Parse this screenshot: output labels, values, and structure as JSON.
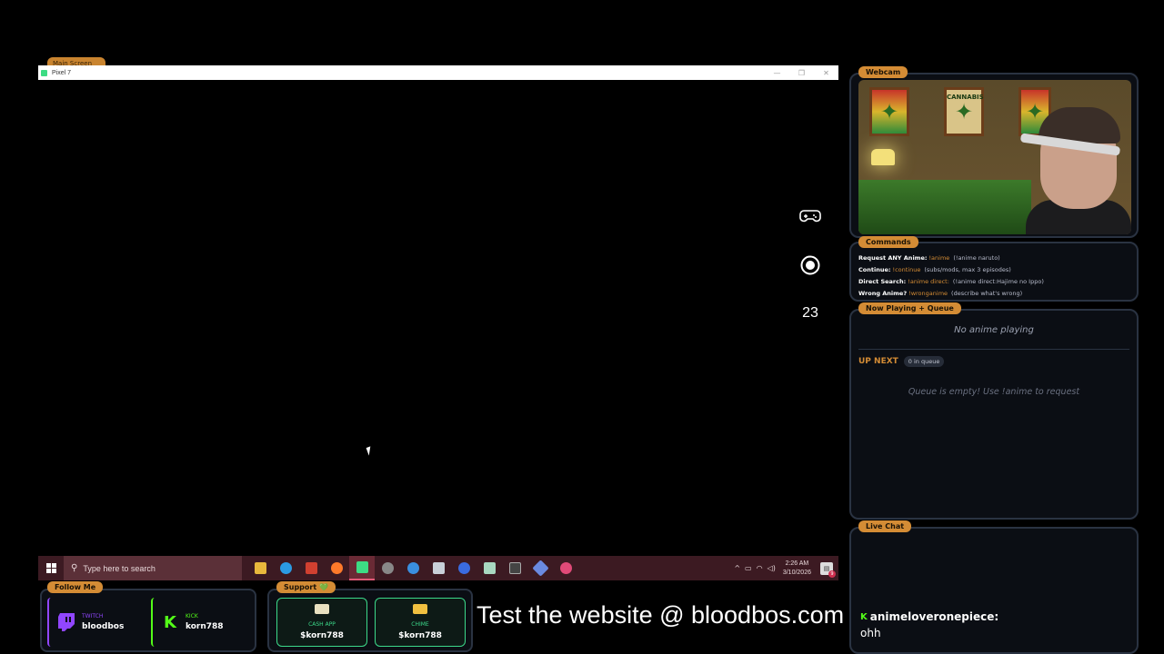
{
  "window": {
    "label": "Main Screen",
    "title": "Pixel 7",
    "controls": [
      "—",
      "❐",
      "✕"
    ],
    "side_number": "23"
  },
  "taskbar": {
    "search_placeholder": "Type here to search",
    "apps": [
      {
        "name": "file-explorer",
        "color": "#e8b83c"
      },
      {
        "name": "edge",
        "color": "#2b9be3"
      },
      {
        "name": "voicemeeter",
        "color": "#d04030"
      },
      {
        "name": "firefox",
        "color": "#ff7a2a"
      },
      {
        "name": "android-emulator",
        "color": "#3ddc84",
        "active": true
      },
      {
        "name": "obs",
        "color": "#888888"
      },
      {
        "name": "ie",
        "color": "#3a8fe0"
      },
      {
        "name": "app-window",
        "color": "#c8d0d8"
      },
      {
        "name": "media-player",
        "color": "#3a6be0"
      },
      {
        "name": "notepad",
        "color": "#a8d8c0"
      },
      {
        "name": "terminal",
        "color": "#444444"
      },
      {
        "name": "dev-tool",
        "color": "#6a8ae0"
      },
      {
        "name": "music-app",
        "color": "#e04a78"
      }
    ],
    "clock_time": "2:26 AM",
    "clock_date": "3/10/2026",
    "notification_count": "9"
  },
  "follow": {
    "label": "Follow Me",
    "twitch_platform": "TWITCH",
    "twitch_user": "bloodbos",
    "kick_platform": "KICK",
    "kick_user": "korn788"
  },
  "support": {
    "label": "Support 💚",
    "cashapp_name": "CASH APP",
    "cashapp_tag": "$korn788",
    "chime_name": "CHIME",
    "chime_tag": "$korn788"
  },
  "banner": "Test the website @ bloodbos.com",
  "webcam": {
    "label": "Webcam",
    "poster_text": "CANNABIS"
  },
  "commands": {
    "label": "Commands",
    "items": [
      {
        "label": "Request ANY Anime:",
        "code": "!anime",
        "desc": "(!anime naruto)"
      },
      {
        "label": "Continue:",
        "code": "!continue",
        "desc": "(subs/mods, max 3 episodes)"
      },
      {
        "label": "Direct Search:",
        "code": "!anime direct:",
        "desc": "(!anime direct:Hajime no Ippo)"
      },
      {
        "label": "Wrong Anime?",
        "code": "!wronganime",
        "desc": "(describe what's wrong)"
      }
    ]
  },
  "queue": {
    "label": "Now Playing + Queue",
    "now_playing": "No anime playing",
    "up_next_label": "UP NEXT",
    "queue_count": "0 in queue",
    "empty_text": "Queue is empty! Use !anime to request"
  },
  "chat": {
    "label": "Live Chat",
    "messages": [
      {
        "user": "animeloveronepiece:",
        "text": "ohh"
      }
    ]
  },
  "colors": {
    "accent": "#d48c35",
    "twitch": "#9146ff",
    "kick": "#53fc18",
    "payment": "#3cd98a",
    "taskbar": "#3c1a22"
  }
}
